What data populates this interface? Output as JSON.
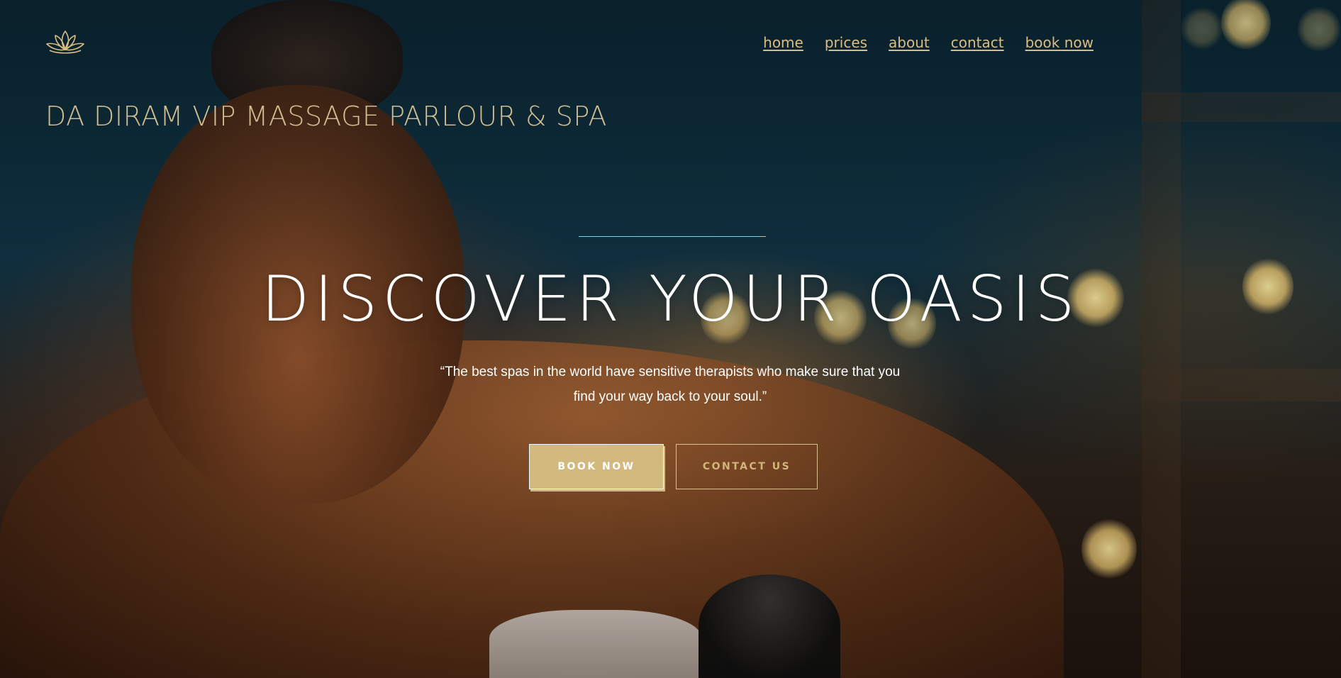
{
  "header": {
    "logo_icon": "lotus-icon",
    "nav": [
      {
        "label": "home"
      },
      {
        "label": "prices"
      },
      {
        "label": "about"
      },
      {
        "label": "contact"
      },
      {
        "label": "book now"
      }
    ],
    "brand_name": "DA DIRAM VIP MASSAGE PARLOUR & SPA"
  },
  "hero": {
    "headline": "DISCOVER YOUR OASIS",
    "quote_line1": "“The best spas in the world have sensitive therapists who make sure that you",
    "quote_line2": "find your way back to your soul.”",
    "primary_button": "BOOK NOW",
    "secondary_button": "CONTACT US"
  },
  "colors": {
    "accent_gold": "#d4b97e",
    "brand_text": "#d2bd93",
    "nav_text": "#d9bd85",
    "headline_text": "#ffffff"
  }
}
